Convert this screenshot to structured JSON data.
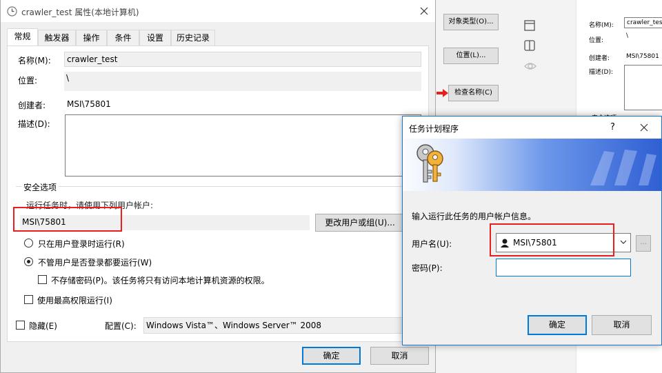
{
  "background": {
    "buttons": [
      "对象类型(O)...",
      "位置(L)...",
      "检查名称(C)"
    ],
    "labels": {
      "name": "名称(M):",
      "location": "位置:",
      "creator": "创建者:",
      "desc": "描述(D):",
      "security": "安全选项"
    },
    "values": {
      "name": "crawler_test",
      "location": "\\",
      "creator": "MSI\\75801"
    }
  },
  "main_dialog": {
    "title": "crawler_test 属性(本地计算机)",
    "tabs": [
      "常规",
      "触发器",
      "操作",
      "条件",
      "设置",
      "历史记录"
    ],
    "active_tab": "常规",
    "fields": {
      "name_label": "名称(M):",
      "name_value": "crawler_test",
      "location_label": "位置:",
      "location_value": "\\",
      "author_label": "创建者:",
      "author_value": "MSI\\75801",
      "desc_label": "描述(D):"
    },
    "security": {
      "group_label": "安全选项",
      "run_as_label": "运行任务时，请使用下列用户帐户:",
      "user_value": "MSI\\75801",
      "change_button": "更改用户或组(U)...",
      "radio_logged_on": "只在用户登录时运行(R)",
      "radio_whether": "不管用户是否登录都要运行(W)",
      "radio_selected": "whether",
      "no_store_password": "不存储密码(P)。该任务将只有访问本地计算机资源的权限。",
      "highest_priv": "使用最高权限运行(I)"
    },
    "hidden_label": "隐藏(E)",
    "config_label": "配置(C):",
    "config_value": "Windows Vista™、Windows Server™ 2008",
    "ok": "确定",
    "cancel": "取消"
  },
  "sub_dialog": {
    "title": "任务计划程序",
    "help": "?",
    "prompt": "输入运行此任务的用户帐户信息。",
    "username_label": "用户名(U):",
    "username_value": "MSI\\75801",
    "browse": "...",
    "password_label": "密码(P):",
    "password_value": "",
    "ok": "确定",
    "cancel": "取消"
  },
  "colors": {
    "highlight": "#e81e1e",
    "accent": "#0078d7",
    "banner": "#2f5fd3"
  }
}
